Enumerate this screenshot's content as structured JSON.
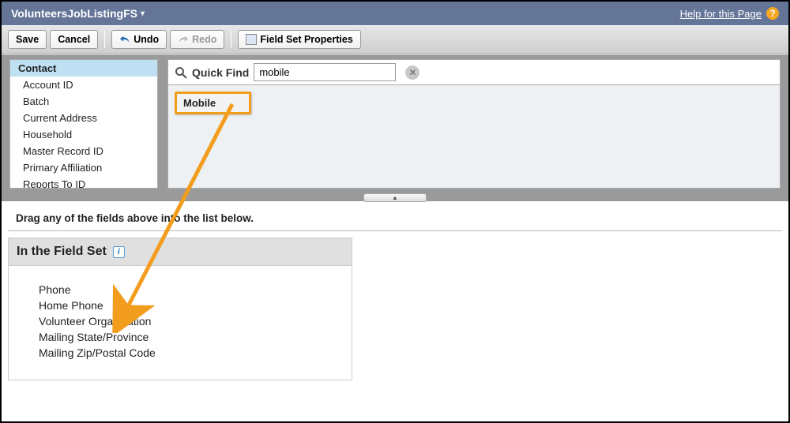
{
  "header": {
    "title": "VolunteersJobListingFS",
    "help_label": "Help for this Page"
  },
  "toolbar": {
    "save": "Save",
    "cancel": "Cancel",
    "undo": "Undo",
    "redo": "Redo",
    "properties": "Field Set Properties"
  },
  "sidebar": {
    "items": [
      "Contact",
      "Account ID",
      "Batch",
      "Current Address",
      "Household",
      "Master Record ID",
      "Primary Affiliation",
      "Reports To ID"
    ]
  },
  "quickfind": {
    "label": "Quick Find",
    "value": "mobile"
  },
  "palette": {
    "result": "Mobile"
  },
  "instructions": "Drag any of the fields above into the list below.",
  "fieldset": {
    "title": "In the Field Set",
    "items": [
      "Phone",
      "Home Phone",
      "Volunteer Organization",
      "Mailing State/Province",
      "Mailing Zip/Postal Code"
    ]
  }
}
